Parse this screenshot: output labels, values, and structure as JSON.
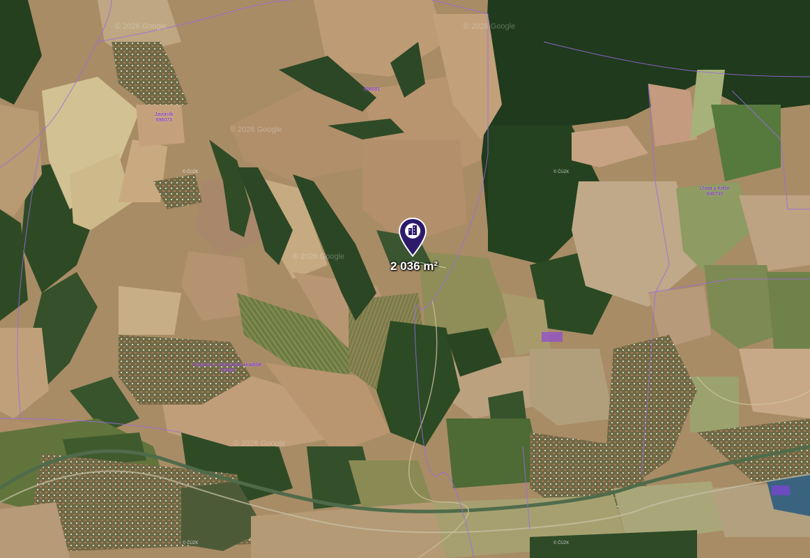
{
  "map": {
    "type": "satellite",
    "accent_color": "#2e1a6b",
    "boundary_color": "#9a6be0",
    "label_color": "#7a1fd6"
  },
  "marker": {
    "icon": "building-icon",
    "area_label": "2 036 m²"
  },
  "region_labels": [
    {
      "name": "Javorník",
      "code": "696073"
    },
    {
      "name": "",
      "code": "696081"
    },
    {
      "name": "Lhota u Kelče",
      "code": "646733"
    },
    {
      "name": "Popovice u Uherského Hradiště",
      "code": "729862"
    }
  ],
  "attribution": {
    "google": "© 2026 Google",
    "cuzk": "© ČÚZK"
  }
}
